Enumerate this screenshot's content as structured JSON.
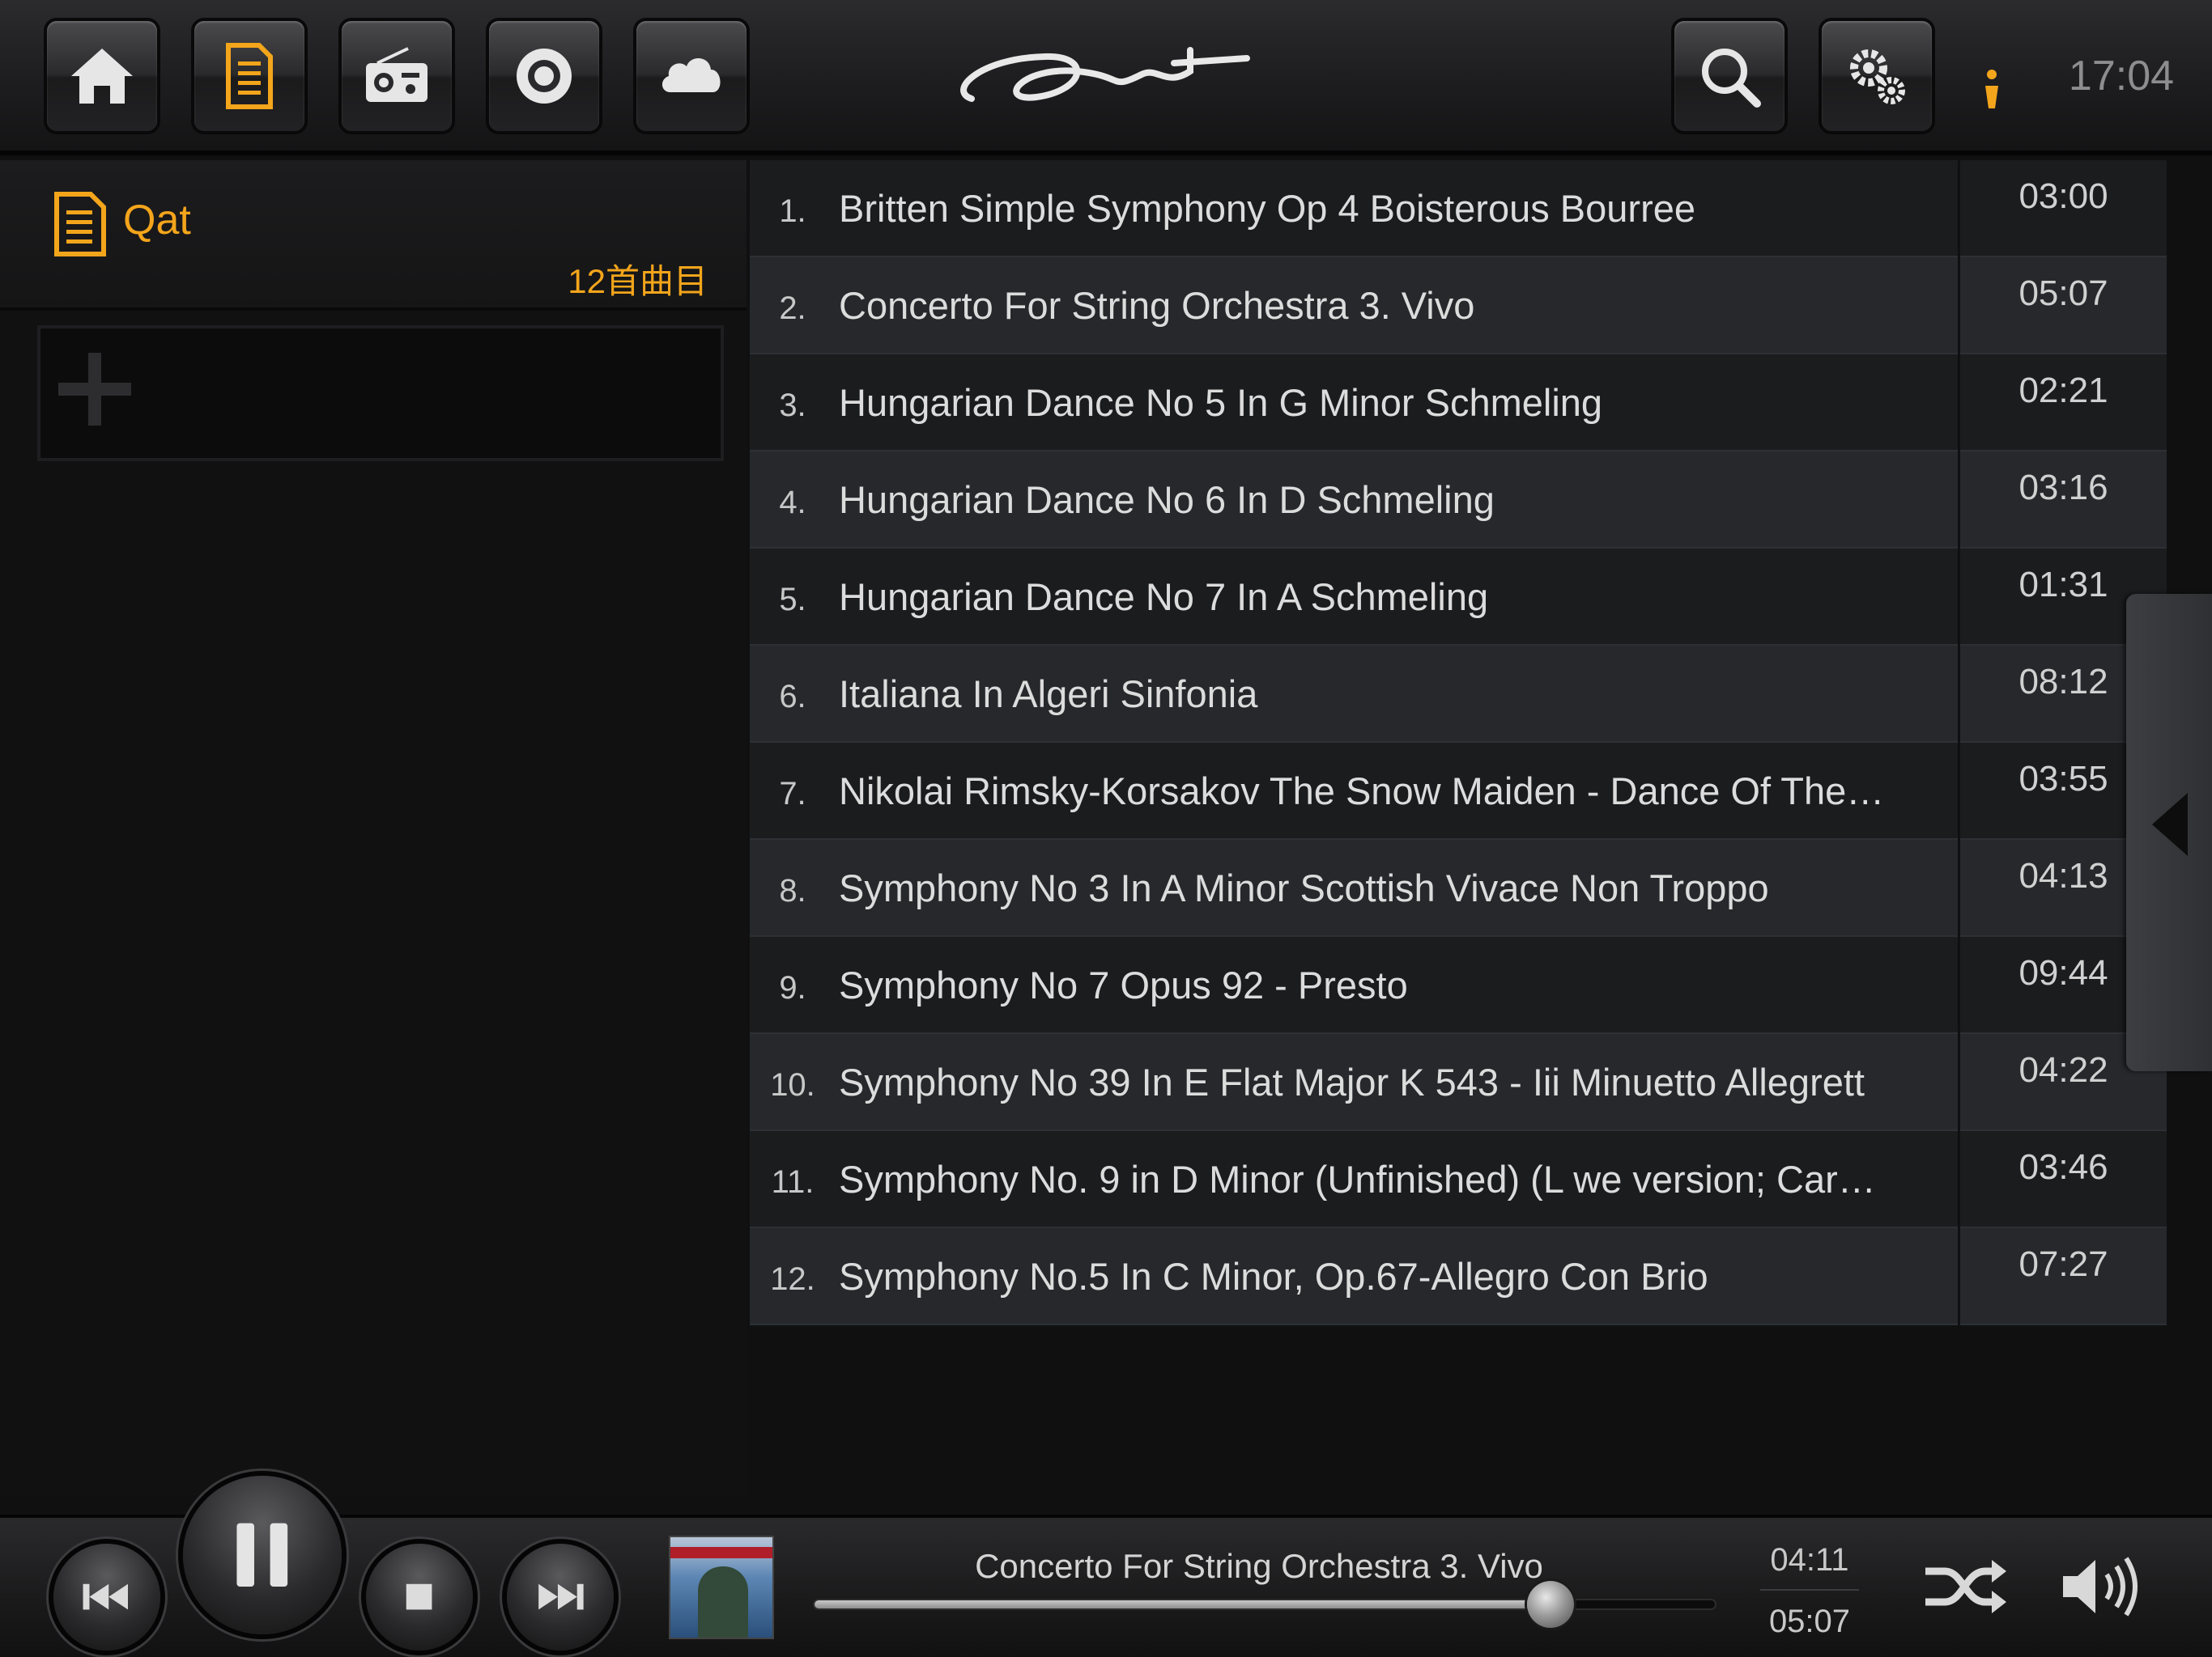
{
  "topbar": {
    "nav_buttons": [
      {
        "name": "home-icon",
        "active": false
      },
      {
        "name": "playlist-icon",
        "active": true
      },
      {
        "name": "radio-icon",
        "active": false
      },
      {
        "name": "disc-icon",
        "active": false
      },
      {
        "name": "cloud-icon",
        "active": false
      }
    ],
    "right_buttons": [
      {
        "name": "search-icon"
      },
      {
        "name": "settings-gears-icon"
      }
    ],
    "logo": "signature-logo",
    "status_icon": "warning-indicator-icon",
    "clock": "17:04"
  },
  "colors": {
    "accent": "#f3a51b",
    "row_odd": "#1b1c1e",
    "row_even": "#26282c",
    "text": "#dcdcdc"
  },
  "sidebar": {
    "playlist_name": "Qat",
    "track_count": "12首曲目",
    "add_icon": "plus-icon"
  },
  "tracks": [
    {
      "num": "1.",
      "title": "Britten Simple Symphony Op 4 Boisterous Bourree",
      "duration": "03:00"
    },
    {
      "num": "2.",
      "title": "Concerto For String Orchestra 3. Vivo",
      "duration": "05:07"
    },
    {
      "num": "3.",
      "title": "Hungarian Dance No 5 In G Minor Schmeling",
      "duration": "02:21"
    },
    {
      "num": "4.",
      "title": "Hungarian Dance No 6 In D Schmeling",
      "duration": "03:16"
    },
    {
      "num": "5.",
      "title": "Hungarian Dance No 7 In A Schmeling",
      "duration": "01:31"
    },
    {
      "num": "6.",
      "title": "Italiana In Algeri  Sinfonia",
      "duration": "08:12"
    },
    {
      "num": "7.",
      "title": "Nikolai Rimsky-Korsakov The Snow Maiden - Dance Of The…",
      "duration": "03:55"
    },
    {
      "num": "8.",
      "title": "Symphony No 3 In A Minor Scottish Vivace Non Troppo",
      "duration": "04:13"
    },
    {
      "num": "9.",
      "title": "Symphony No 7 Opus 92 - Presto",
      "duration": "09:44"
    },
    {
      "num": "10.",
      "title": "Symphony No 39 In E Flat Major K 543 - Iii Minuetto Allegrett",
      "duration": "04:22"
    },
    {
      "num": "11.",
      "title": "Symphony No. 9 in D Minor  (Unfinished) (L we version; Car…",
      "duration": "03:46"
    },
    {
      "num": "12.",
      "title": "Symphony No.5 In C Minor, Op.67-Allegro Con Brio",
      "duration": "07:27"
    }
  ],
  "side_tab": {
    "icon": "collapse-left-arrow-icon"
  },
  "player": {
    "now_playing": "Concerto For String Orchestra 3. Vivo",
    "elapsed": "04:11",
    "total": "05:07",
    "progress": 0.8176,
    "controls": [
      "previous-icon",
      "pause-icon",
      "stop-icon",
      "next-icon"
    ],
    "shuffle_icon": "shuffle-icon",
    "volume_icon": "volume-icon",
    "album_art": "album-cover-image"
  }
}
